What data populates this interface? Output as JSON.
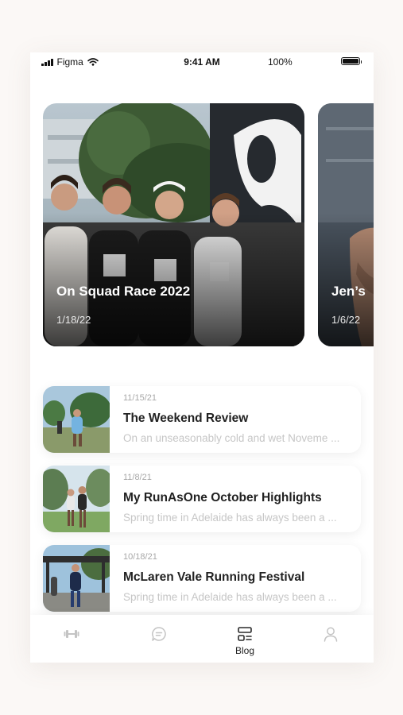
{
  "status_bar": {
    "carrier": "Figma",
    "time": "9:41 AM",
    "battery": "100%"
  },
  "featured": [
    {
      "title": "On Squad Race 2022",
      "date": "1/18/22"
    },
    {
      "title": "Jen’s",
      "date": "1/6/22"
    }
  ],
  "posts": [
    {
      "date": "11/15/21",
      "title": "The Weekend Review",
      "excerpt": "On an unseasonably cold and wet Noveme ..."
    },
    {
      "date": "11/8/21",
      "title": "My RunAsOne October Highlights",
      "excerpt": "Spring time in Adelaide has always been a ..."
    },
    {
      "date": "10/18/21",
      "title": "McLaren Vale Running Festival",
      "excerpt": "Spring time in Adelaide has always been a ..."
    }
  ],
  "tab_bar": {
    "active": "Blog",
    "tabs": [
      {
        "icon": "dumbbell-icon"
      },
      {
        "icon": "chat-bubble-icon"
      },
      {
        "icon": "blog-icon",
        "label": "Blog"
      },
      {
        "icon": "profile-icon"
      }
    ]
  }
}
